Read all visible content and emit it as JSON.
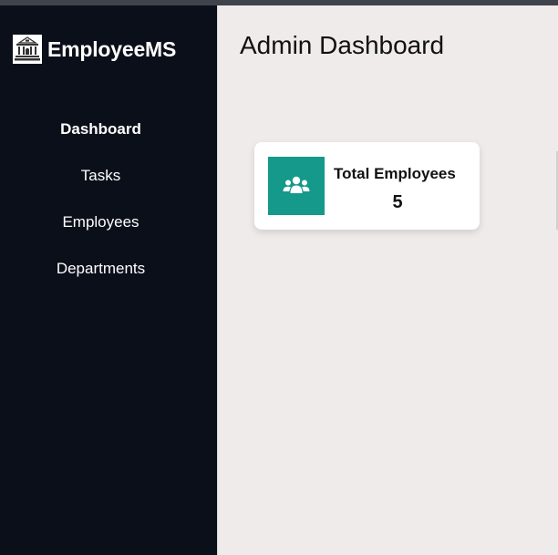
{
  "sidebar": {
    "brand": "EmployeeMS",
    "logo_icon": "building-icon",
    "background": "#0a0f1a",
    "items": [
      {
        "label": "Dashboard",
        "active": true
      },
      {
        "label": "Tasks",
        "active": false
      },
      {
        "label": "Employees",
        "active": false
      },
      {
        "label": "Departments",
        "active": false
      }
    ]
  },
  "main": {
    "title": "Admin Dashboard",
    "cards": [
      {
        "label": "Total Employees",
        "value": "5",
        "icon": "users-icon",
        "accent": "#14998a"
      }
    ]
  }
}
